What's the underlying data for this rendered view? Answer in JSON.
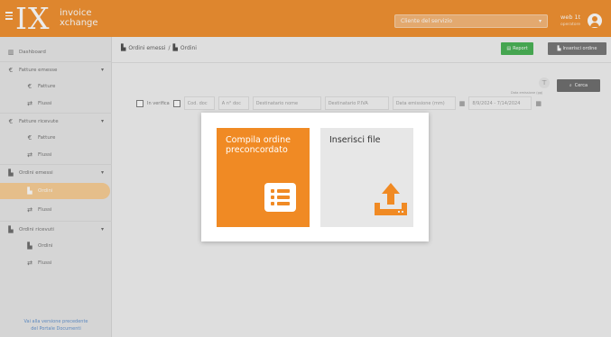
{
  "topbar": {
    "logo_mark": "IX",
    "logo_word_1": "invoice",
    "logo_word_2": "xchange",
    "client_placeholder": "Cliente del servizio",
    "user_name": "web 1t",
    "user_sub": "operatore",
    "accent_color": "#f08a24"
  },
  "sidebar": {
    "items": [
      {
        "label": "Dashboard",
        "icon": "chart-icon"
      },
      {
        "label": "Fatture emesse",
        "icon": "euro-icon"
      },
      {
        "label": "Fatture",
        "icon": "euro-icon"
      },
      {
        "label": "Flussi",
        "icon": "transfer-icon"
      },
      {
        "label": "Fatture ricevute",
        "icon": "euro-icon"
      },
      {
        "label": "Fatture",
        "icon": "euro-icon"
      },
      {
        "label": "Flussi",
        "icon": "transfer-icon"
      },
      {
        "label": "Ordini emessi",
        "icon": "document-icon"
      },
      {
        "label": "Ordini",
        "icon": "document-icon"
      },
      {
        "label": "Flussi",
        "icon": "transfer-icon"
      },
      {
        "label": "Ordini ricevuti",
        "icon": "document-icon"
      },
      {
        "label": "Ordini",
        "icon": "document-icon"
      },
      {
        "label": "Flussi",
        "icon": "transfer-icon"
      }
    ],
    "footer_line_1": "Vai alla versione precedente",
    "footer_line_2": "del Portale Documenti"
  },
  "main": {
    "breadcrumb": [
      "Ordini emessi",
      "Ordini"
    ],
    "report_label": "Report",
    "insert_order_label": "Inserisci ordine",
    "search_label": "Cerca",
    "filters": {
      "in_verifica": "In verifica",
      "cod_doc": "Cod. doc",
      "anno_doc": "A n° doc",
      "destinatario": "Destinatario nome",
      "destinatario_piva": "Destinatario P.IVA",
      "data_emissione": "Data emissione (mm)",
      "date_range_label": "Data emissione (gg)",
      "date_range": "8/9/2024 - 7/14/2024"
    }
  },
  "modal": {
    "option_1_title": "Compila ordine preconcordato",
    "option_1_icon": "list-icon",
    "option_2_title": "Inserisci file",
    "option_2_icon": "upload-icon"
  }
}
